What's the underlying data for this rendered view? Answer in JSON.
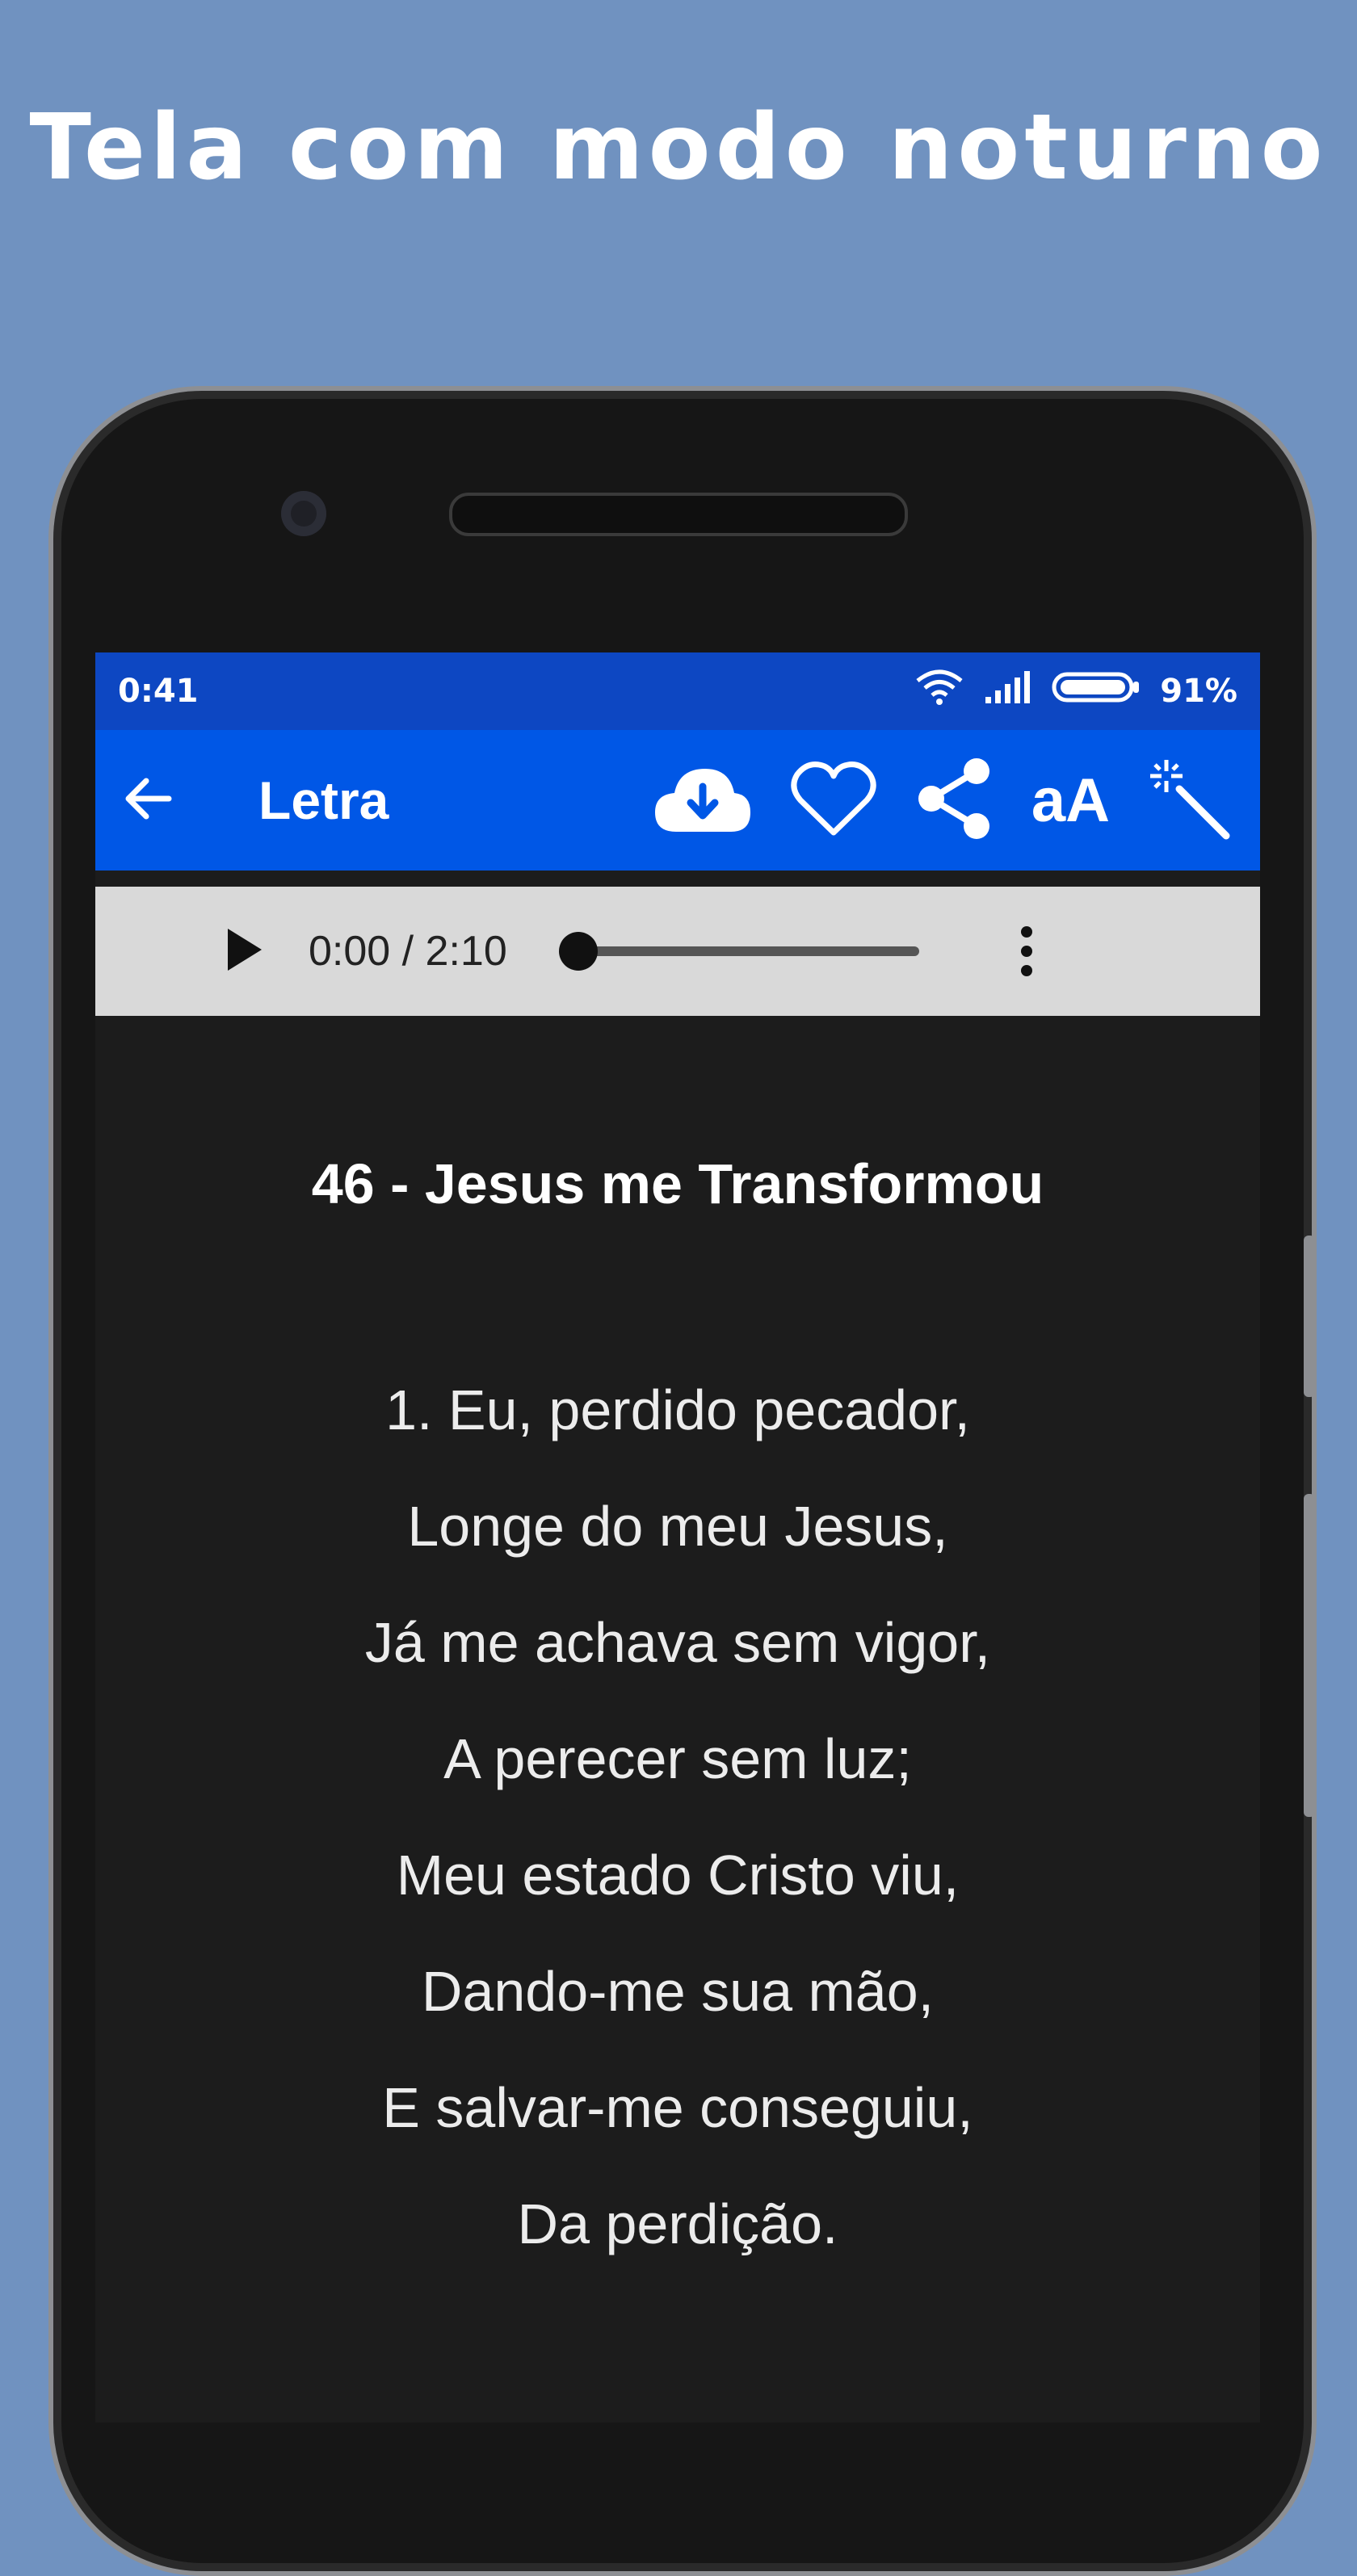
{
  "promo": {
    "headline": "Tela com modo noturno"
  },
  "status_bar": {
    "time": "0:41",
    "battery": "91%"
  },
  "app_bar": {
    "title": "Letra",
    "back_icon": "arrow-left-icon",
    "actions": [
      "cloud-download-icon",
      "heart-icon",
      "share-icon",
      "font-size-toggle",
      "magic-wand-icon"
    ],
    "font_toggle_label": "aA"
  },
  "player": {
    "time": "0:00 / 2:10",
    "progress": 0.0
  },
  "song": {
    "title": "46 - Jesus me Transformou",
    "lines": [
      "1. Eu, perdido pecador,",
      "Longe do meu Jesus,",
      "Já me achava sem vigor,",
      "A perecer sem luz;",
      "Meu estado Cristo viu,",
      "Dando-me sua mão,",
      "E salvar-me conseguiu,",
      "Da perdição."
    ]
  },
  "colors": {
    "background": "#7092c0",
    "status_bar": "#0d47c2",
    "app_bar": "#0057e6",
    "content_bg": "#1c1c1c",
    "player_bg": "#d9d9d9"
  }
}
